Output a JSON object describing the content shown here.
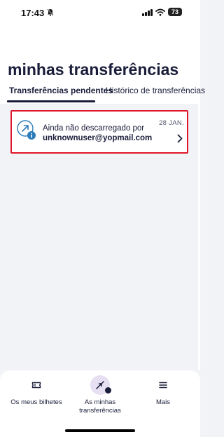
{
  "status_bar": {
    "time": "17:43",
    "battery": "73"
  },
  "page": {
    "title": "minhas transferências"
  },
  "tabs": [
    {
      "label": "Transferências pendentes",
      "active": true
    },
    {
      "label": "Histórico de transferências",
      "active": false
    }
  ],
  "transfer": {
    "status_text": "Ainda não descarregado por",
    "email": "unknownuser@yopmail.com",
    "date": "28 JAN.",
    "icon": "transfer-arrow-icon",
    "badge_icon": "info-icon"
  },
  "bottom_nav": {
    "items": [
      {
        "label": "Os meus bilhetes",
        "icon": "ticket-icon"
      },
      {
        "label": "As minhas transferências",
        "label_line1": "As minhas",
        "label_line2": "transferências",
        "icon": "transfer-swap-icon",
        "active": true
      },
      {
        "label": "Mais",
        "icon": "menu-icon"
      }
    ]
  },
  "colors": {
    "primary": "#1a1d3a",
    "highlight_border": "#e0162b",
    "active_bubble": "#e6e0f2",
    "icon_blue": "#2b7bb9"
  }
}
